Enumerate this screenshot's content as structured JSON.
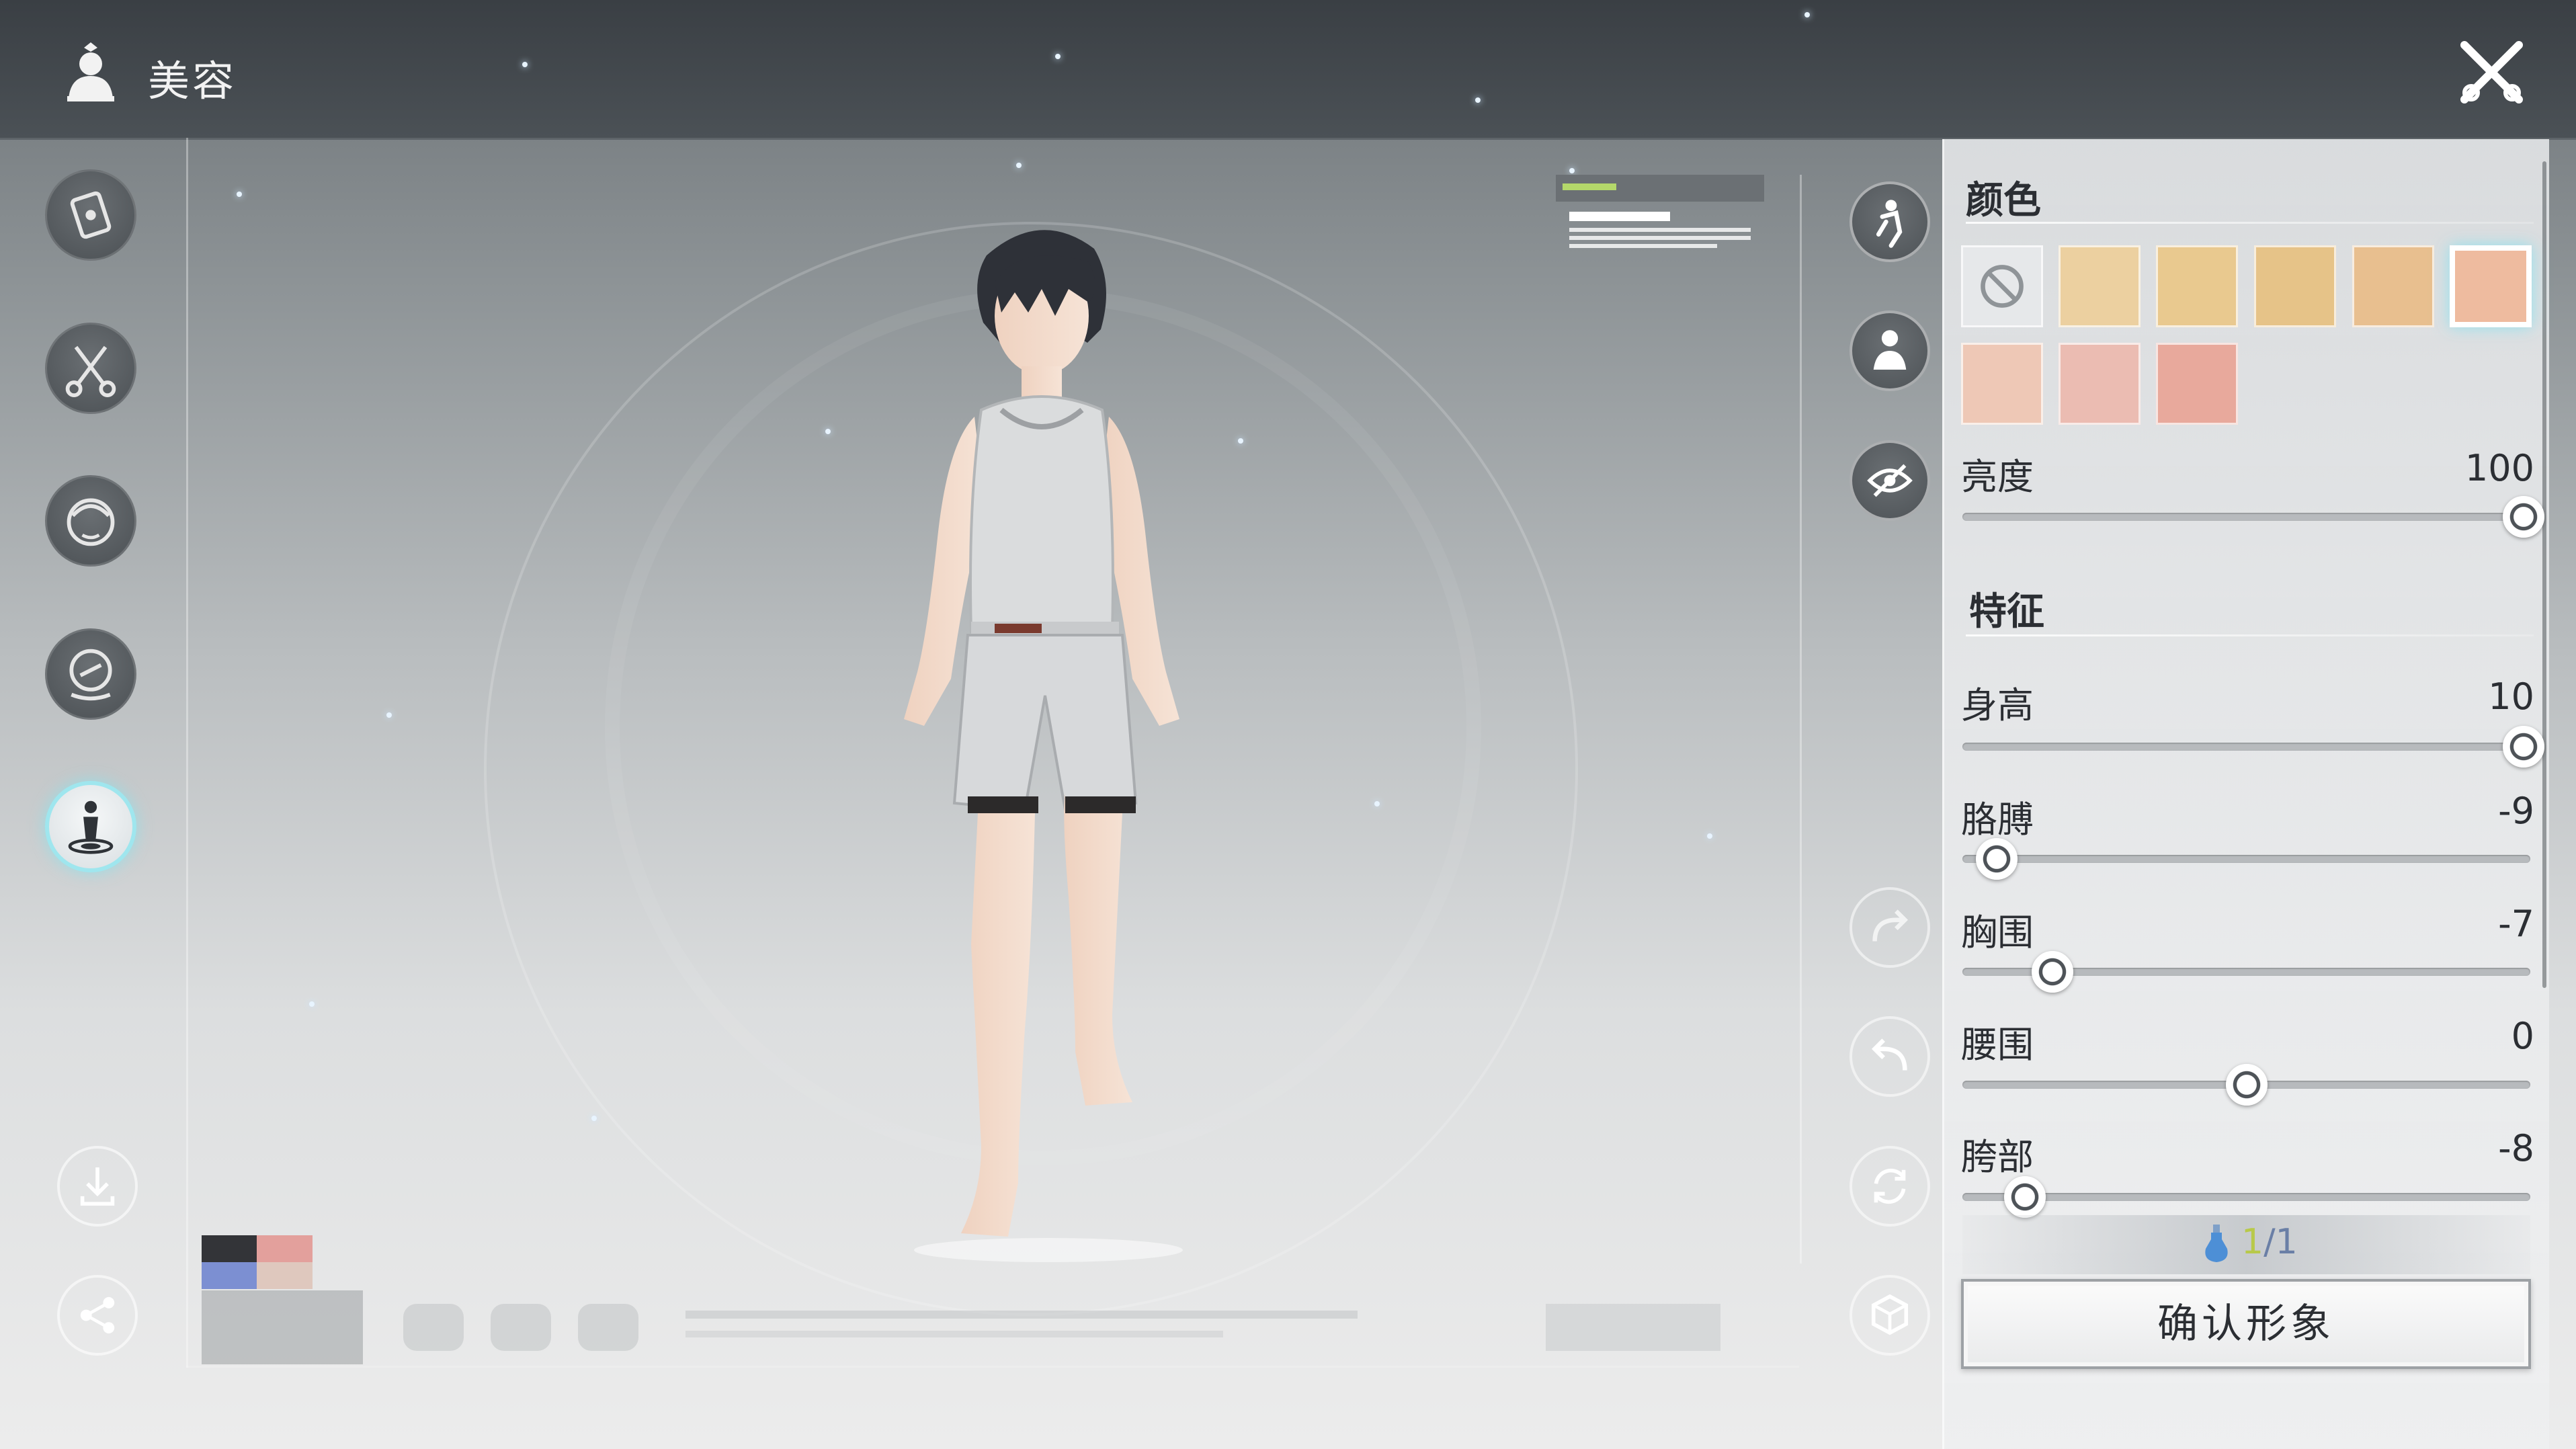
{
  "header": {
    "title": "美容",
    "title_icon": "character-bust-icon",
    "close_icon": "close-x-icon"
  },
  "left_menu": [
    {
      "name": "card-icon",
      "active": false
    },
    {
      "name": "scissors-icon",
      "active": false
    },
    {
      "name": "face-icon",
      "active": false
    },
    {
      "name": "badge-icon",
      "active": false
    },
    {
      "name": "body-stand-icon",
      "active": true
    }
  ],
  "left_bottom": [
    "download-icon",
    "share-icon"
  ],
  "right_tools": [
    "pose-icon",
    "outfit-icon",
    "hide-eye-icon",
    "redo-icon",
    "undo-icon",
    "reset-icon",
    "random-dice-icon"
  ],
  "panel": {
    "color": {
      "title": "颜色",
      "swatches": [
        {
          "color": "none",
          "selected": false
        },
        {
          "color": "#ecd0a0",
          "selected": false
        },
        {
          "color": "#e9c98f",
          "selected": false
        },
        {
          "color": "#e6c388",
          "selected": false
        },
        {
          "color": "#e8bf8f",
          "selected": false
        },
        {
          "color": "#eebb9f",
          "selected": true
        },
        {
          "color": "#eec8b6",
          "selected": false
        },
        {
          "color": "#ebbcb2",
          "selected": false
        },
        {
          "color": "#e8a99c",
          "selected": false
        }
      ]
    },
    "brightness": {
      "label": "亮度",
      "value": "100",
      "fraction": 1.0
    },
    "features": {
      "title": "特征",
      "sliders": [
        {
          "label": "身高",
          "value": "10",
          "fraction": 1.0
        },
        {
          "label": "胳膊",
          "value": "-9",
          "fraction": 0.05
        },
        {
          "label": "胸围",
          "value": "-7",
          "fraction": 0.15
        },
        {
          "label": "腰围",
          "value": "0",
          "fraction": 0.5
        },
        {
          "label": "胯部",
          "value": "-8",
          "fraction": 0.1
        }
      ]
    },
    "cost": {
      "current": "1",
      "separator": "/",
      "total": "1",
      "icon": "potion-bottle-icon"
    },
    "confirm_label": "确认形象"
  },
  "legend_colors": [
    "#333438",
    "#e3a09c",
    "#7c8fd2",
    "#dfc8be"
  ]
}
